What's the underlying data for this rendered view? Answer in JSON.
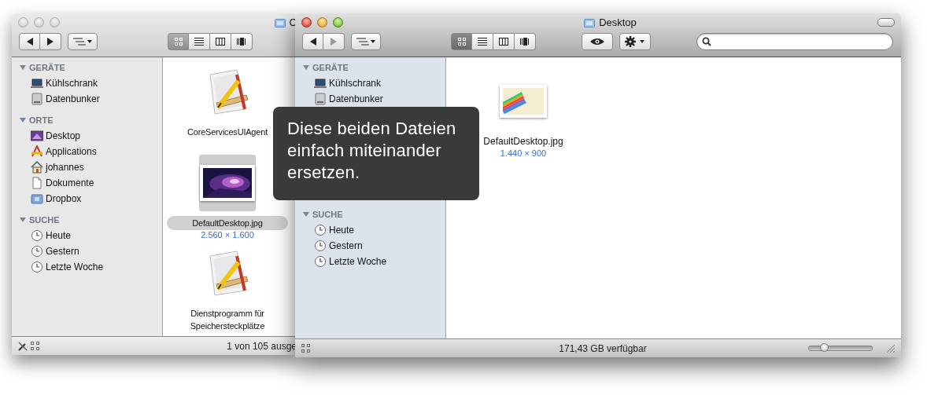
{
  "windows": [
    {
      "kind": "back",
      "active": false,
      "title": "C",
      "view_modes": [
        {
          "kind": "icons",
          "selected": true
        },
        {
          "kind": "list",
          "selected": false
        },
        {
          "kind": "columns",
          "selected": false
        },
        {
          "kind": "coverflow",
          "selected": false
        }
      ],
      "sidebar": [
        {
          "heading": "GERÄTE",
          "expanded": true,
          "items": [
            {
              "kind": "laptop",
              "label": "Kühlschrank",
              "selected": false
            },
            {
              "kind": "drive",
              "label": "Datenbunker",
              "selected": false
            }
          ]
        },
        {
          "heading": "ORTE",
          "expanded": true,
          "items": [
            {
              "kind": "desktop",
              "label": "Desktop",
              "selected": false
            },
            {
              "kind": "apps",
              "label": "Applications",
              "selected": false
            },
            {
              "kind": "home",
              "label": "johannes",
              "selected": false
            },
            {
              "kind": "docs",
              "label": "Dokumente",
              "selected": false
            },
            {
              "kind": "dropbox",
              "label": "Dropbox",
              "selected": false
            }
          ]
        },
        {
          "heading": "SUCHE",
          "expanded": true,
          "items": [
            {
              "kind": "clock",
              "label": "Heute",
              "selected": false
            },
            {
              "kind": "clock",
              "label": "Gestern",
              "selected": false
            },
            {
              "kind": "clock",
              "label": "Letzte Woche",
              "selected": false
            }
          ]
        }
      ],
      "files": [
        {
          "kind": "app",
          "name": "CoreServicesUIAgent",
          "selected": false
        },
        {
          "kind": "galaxy",
          "name": "DefaultDesktop.jpg",
          "dimensions": "2.560 × 1.600",
          "selected": true
        },
        {
          "kind": "app",
          "name": "Dienstprogramm für Speichersteckplätze",
          "selected": false
        }
      ],
      "status_text": "1 von 105 ausge"
    },
    {
      "kind": "front",
      "active": true,
      "title": "Desktop",
      "view_modes": [
        {
          "kind": "icons",
          "selected": true
        },
        {
          "kind": "list",
          "selected": false
        },
        {
          "kind": "columns",
          "selected": false
        },
        {
          "kind": "coverflow",
          "selected": false
        }
      ],
      "sidebar": [
        {
          "heading": "GERÄTE",
          "expanded": true,
          "items": [
            {
              "kind": "laptop",
              "label": "Kühlschrank",
              "selected": false
            },
            {
              "kind": "drive",
              "label": "Datenbunker",
              "selected": false
            }
          ]
        },
        {
          "heading": "SUCHE",
          "expanded": true,
          "items": [
            {
              "kind": "clock",
              "label": "Heute",
              "selected": false
            },
            {
              "kind": "clock",
              "label": "Gestern",
              "selected": false
            },
            {
              "kind": "clock",
              "label": "Letzte Woche",
              "selected": false
            }
          ]
        }
      ],
      "files": [
        {
          "kind": "rainbow",
          "name": "DefaultDesktop.jpg",
          "dimensions": "1.440 × 900",
          "selected": false
        }
      ],
      "status_text": "171,43 GB verfügbar",
      "zoom": {
        "level": 0.25
      }
    }
  ],
  "tooltip": {
    "text": "Diese beiden Dateien einfach miteinander ersetzen."
  }
}
